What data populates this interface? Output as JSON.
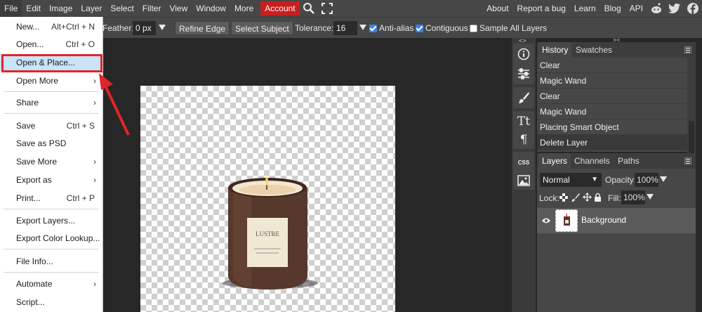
{
  "menubar": {
    "items": [
      "File",
      "Edit",
      "Image",
      "Layer",
      "Select",
      "Filter",
      "View",
      "Window",
      "More"
    ],
    "account": "Account",
    "right_links": [
      "About",
      "Report a bug",
      "Learn",
      "Blog",
      "API"
    ],
    "icons": [
      "search-icon",
      "fullscreen-icon",
      "reddit-icon",
      "twitter-icon",
      "facebook-icon"
    ]
  },
  "options": {
    "feather_label": "Feather:",
    "feather_value": "0 px",
    "refine_edge": "Refine Edge",
    "select_subject": "Select Subject",
    "tolerance_label": "Tolerance:",
    "tolerance_value": "16",
    "anti_alias": "Anti-alias",
    "contiguous": "Contiguous",
    "sample_all_layers": "Sample All Layers"
  },
  "file_menu": {
    "new": "New...",
    "new_sc": "Alt+Ctrl + N",
    "open": "Open...",
    "open_sc": "Ctrl + O",
    "open_place": "Open & Place...",
    "open_more": "Open More",
    "share": "Share",
    "save": "Save",
    "save_sc": "Ctrl + S",
    "save_psd": "Save as PSD",
    "save_more": "Save More",
    "export_as": "Export as",
    "print": "Print...",
    "print_sc": "Ctrl + P",
    "export_layers": "Export Layers...",
    "export_color": "Export Color Lookup...",
    "file_info": "File Info...",
    "automate": "Automate",
    "script": "Script..."
  },
  "history_panel": {
    "tabs": [
      "History",
      "Swatches"
    ],
    "entries": [
      "Clear",
      "Magic Wand",
      "Clear",
      "Magic Wand",
      "Placing Smart Object",
      "Delete Layer"
    ]
  },
  "layers_panel": {
    "tabs": [
      "Layers",
      "Channels",
      "Paths"
    ],
    "blend_mode": "Normal",
    "opacity_label": "Opacity:",
    "opacity_value": "100%",
    "lock_label": "Lock:",
    "fill_label": "Fill:",
    "fill_value": "100%",
    "layer_name": "Background"
  },
  "product": {
    "label_brand": "LUSTRE"
  },
  "colors": {
    "account": "#c71e1e",
    "highlight": "#c9e3f7",
    "arrow": "#e0252a",
    "check": "#3b83e8"
  }
}
